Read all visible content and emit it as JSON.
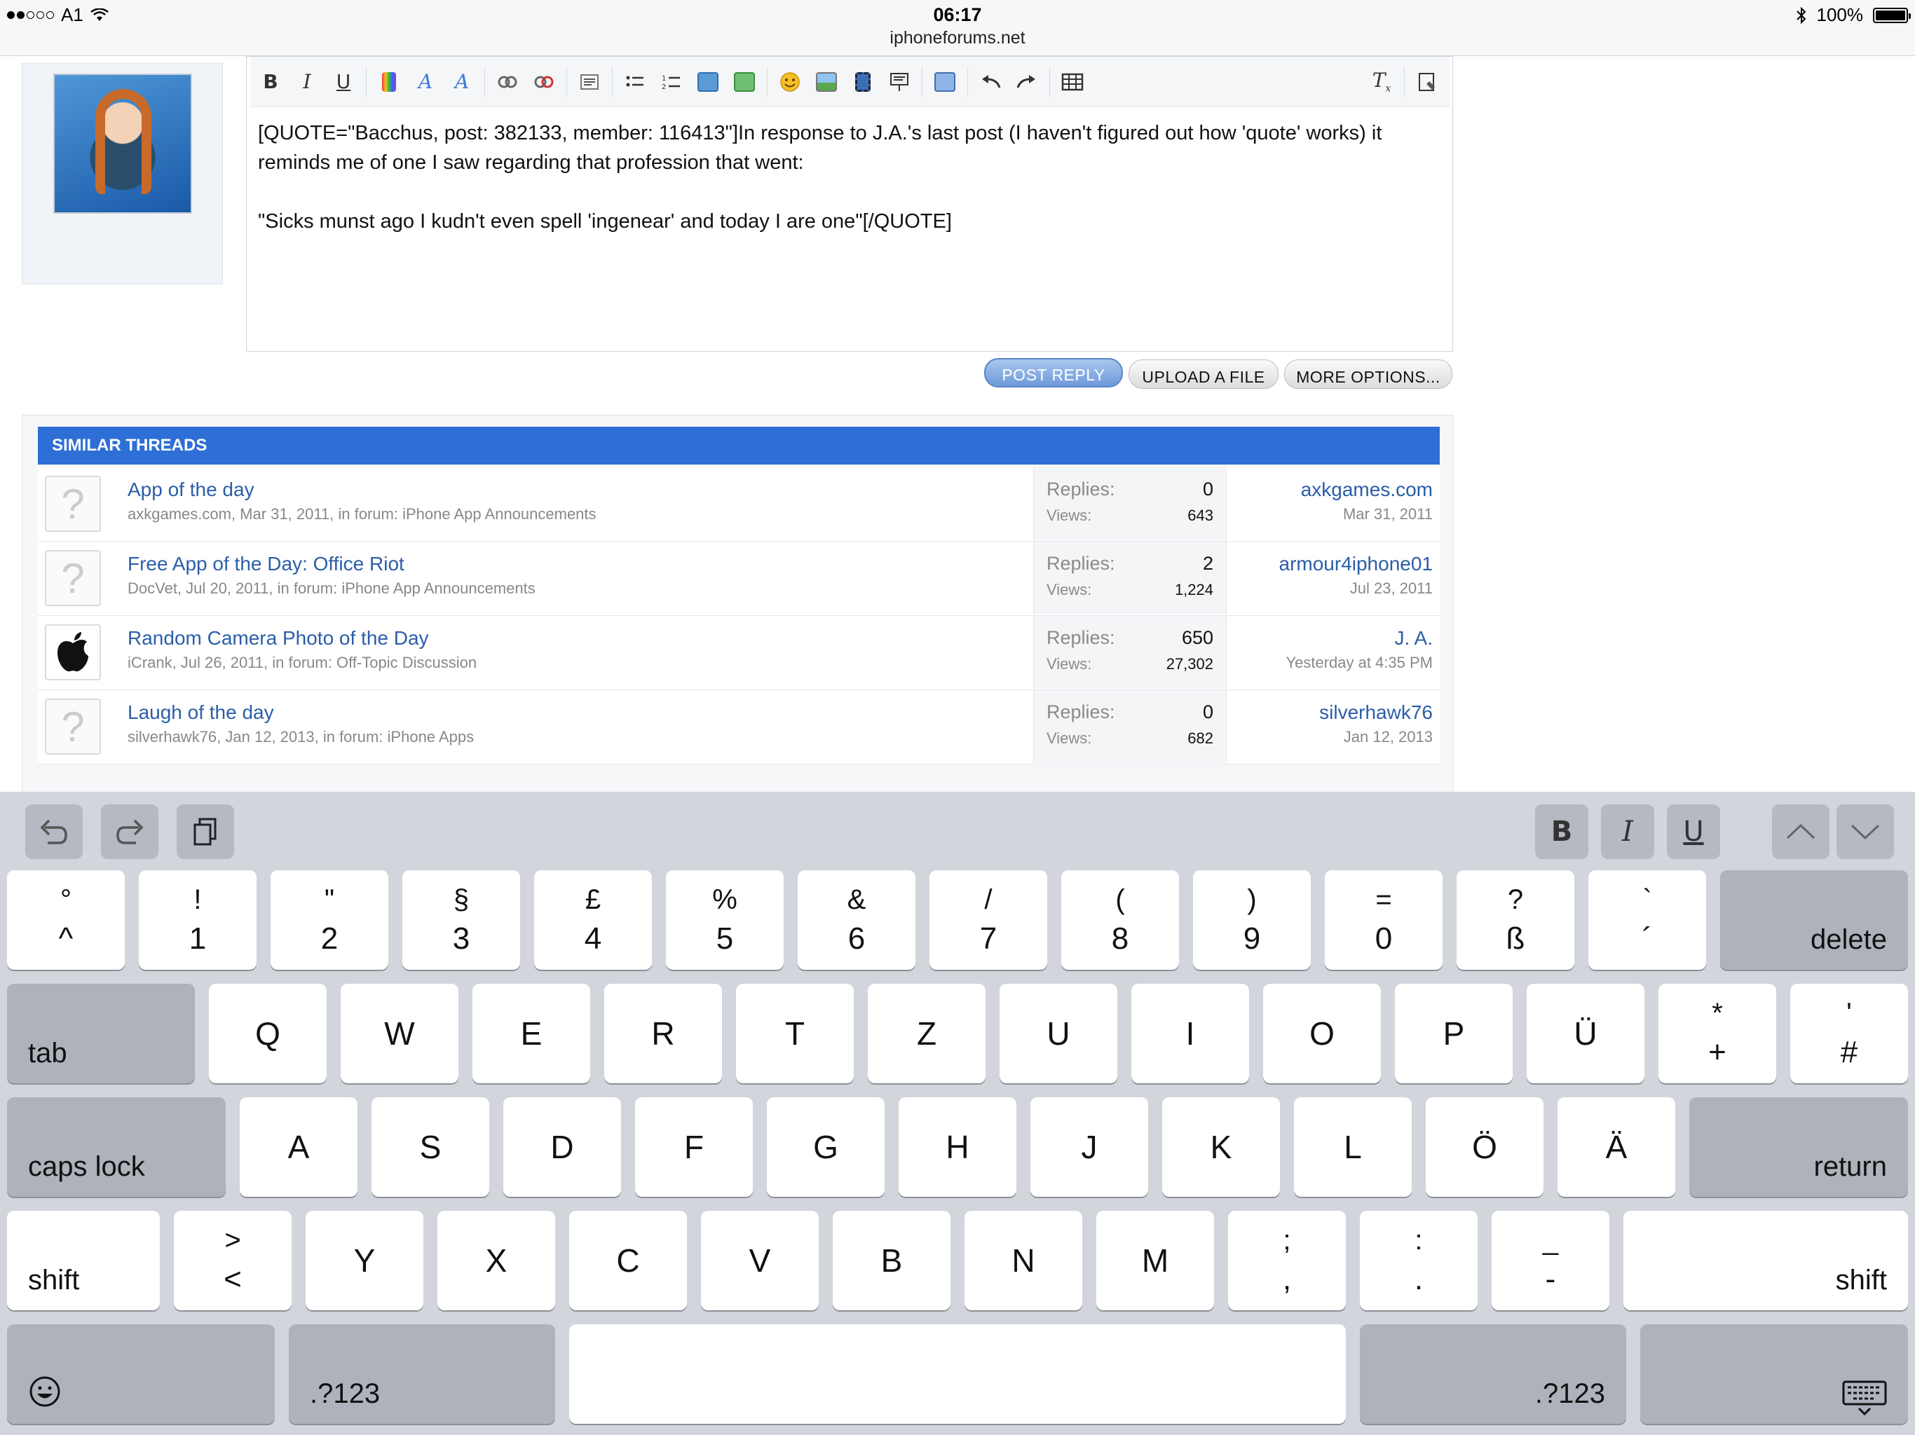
{
  "status_bar": {
    "carrier": "A1",
    "time": "06:17",
    "url": "iphoneforums.net",
    "battery": "100%"
  },
  "editor": {
    "toolbar": {
      "bold": "B",
      "italic": "I",
      "underline": "U"
    },
    "lines": [
      "[QUOTE=\"Bacchus, post: 382133, member: 116413\"]In response to J.A.'s last post (I haven't figured out how 'quote' works) it",
      "reminds me of one I saw regarding that profession that went:",
      "",
      "\"Sicks munst ago I kudn't even spell 'ingenear' and today I are one\"[/QUOTE]"
    ]
  },
  "buttons": {
    "post_reply": "POST REPLY",
    "upload": "UPLOAD A FILE",
    "more": "MORE OPTIONS..."
  },
  "similar": {
    "heading": "SIMILAR THREADS",
    "rows": [
      {
        "title": "App of the day",
        "meta": "axkgames.com, Mar 31, 2011, in forum: iPhone App Announcements",
        "replies_label": "Replies:",
        "replies": "0",
        "views_label": "Views:",
        "views": "643",
        "last_user": "axkgames.com",
        "last_date": "Mar 31, 2011",
        "icon": "question-icon"
      },
      {
        "title": "Free App of the Day: Office Riot",
        "meta": "DocVet, Jul 20, 2011, in forum: iPhone App Announcements",
        "replies_label": "Replies:",
        "replies": "2",
        "views_label": "Views:",
        "views": "1,224",
        "last_user": "armour4iphone01",
        "last_date": "Jul 23, 2011",
        "icon": "question-icon"
      },
      {
        "title": "Random Camera Photo of the Day",
        "meta": "iCrank, Jul 26, 2011, in forum: Off-Topic Discussion",
        "replies_label": "Replies:",
        "replies": "650",
        "views_label": "Views:",
        "views": "27,302",
        "last_user": "J. A.",
        "last_date": "Yesterday at 4:35 PM",
        "icon": "apple-icon"
      },
      {
        "title": "Laugh of the day",
        "meta": "silverhawk76, Jan 12, 2013, in forum: iPhone Apps",
        "replies_label": "Replies:",
        "replies": "0",
        "views_label": "Views:",
        "views": "682",
        "last_user": "silverhawk76",
        "last_date": "Jan 12, 2013",
        "icon": "question-icon"
      }
    ]
  },
  "keyboard": {
    "format": {
      "bold": "B",
      "italic": "I",
      "underline": "U"
    },
    "row1": [
      [
        "°",
        "^"
      ],
      [
        "!",
        "1"
      ],
      [
        "\"",
        "2"
      ],
      [
        "§",
        "3"
      ],
      [
        "£",
        "4"
      ],
      [
        "%",
        "5"
      ],
      [
        "&",
        "6"
      ],
      [
        "/",
        "7"
      ],
      [
        "(",
        "8"
      ],
      [
        ")",
        "9"
      ],
      [
        "=",
        "0"
      ],
      [
        "?",
        "ß"
      ],
      [
        "`",
        "´"
      ]
    ],
    "delete": "delete",
    "tab": "tab",
    "row2": [
      "Q",
      "W",
      "E",
      "R",
      "T",
      "Z",
      "U",
      "I",
      "O",
      "P",
      "Ü"
    ],
    "row2_sym": [
      [
        "*",
        "+"
      ],
      [
        "'",
        "#"
      ]
    ],
    "caps": "caps lock",
    "row3": [
      "A",
      "S",
      "D",
      "F",
      "G",
      "H",
      "J",
      "K",
      "L",
      "Ö",
      "Ä"
    ],
    "return": "return",
    "shift": "shift",
    "row4_first": [
      ">",
      "<"
    ],
    "row4": [
      "Y",
      "X",
      "C",
      "V",
      "B",
      "N",
      "M"
    ],
    "row4_sym": [
      [
        ";",
        ","
      ],
      [
        ":",
        "."
      ],
      [
        "_",
        "-"
      ]
    ],
    "numbers": ".?123"
  }
}
